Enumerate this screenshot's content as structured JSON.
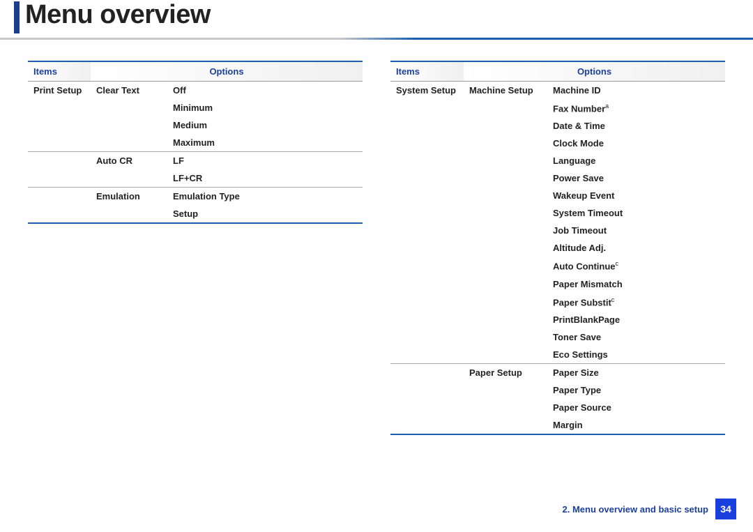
{
  "title": "Menu overview",
  "footer": {
    "chapter": "2.  Menu overview and basic setup",
    "page": "34"
  },
  "left": {
    "header": {
      "items": "Items",
      "options": "Options"
    },
    "category": "Print Setup",
    "rows": [
      {
        "sub": "Clear Text",
        "opts": [
          "Off",
          "Minimum",
          "Medium",
          "Maximum"
        ]
      },
      {
        "sub": "Auto CR",
        "opts": [
          "LF",
          "LF+CR"
        ]
      },
      {
        "sub": "Emulation",
        "opts": [
          "Emulation Type",
          "Setup"
        ]
      }
    ]
  },
  "right": {
    "header": {
      "items": "Items",
      "options": "Options"
    },
    "category": "System Setup",
    "rows": [
      {
        "sub": "Machine Setup",
        "opts": [
          {
            "t": "Machine ID"
          },
          {
            "t": "Fax Number",
            "sup": "a"
          },
          {
            "t": "Date & Time"
          },
          {
            "t": "Clock Mode"
          },
          {
            "t": "Language"
          },
          {
            "t": "Power Save"
          },
          {
            "t": "Wakeup Event"
          },
          {
            "t": "System Timeout"
          },
          {
            "t": "Job Timeout"
          },
          {
            "t": "Altitude Adj."
          },
          {
            "t": "Auto Continue",
            "sup": "c"
          },
          {
            "t": "Paper Mismatch"
          },
          {
            "t": "Paper Substit",
            "sup": "c"
          },
          {
            "t": "PrintBlankPage"
          },
          {
            "t": "Toner Save"
          },
          {
            "t": "Eco Settings"
          }
        ]
      },
      {
        "sub": "Paper Setup",
        "opts": [
          {
            "t": "Paper Size"
          },
          {
            "t": "Paper Type"
          },
          {
            "t": "Paper Source"
          },
          {
            "t": "Margin"
          }
        ]
      }
    ]
  }
}
